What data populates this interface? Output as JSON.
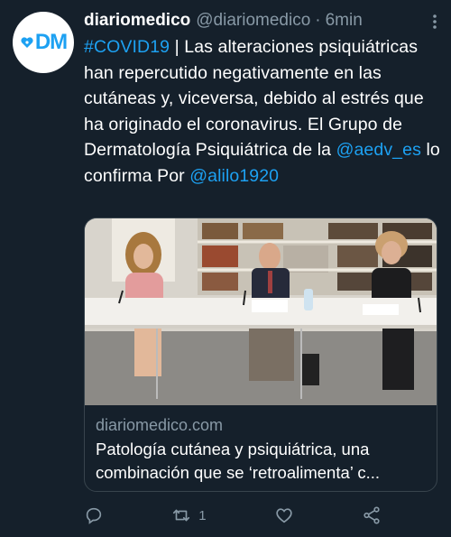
{
  "tweet": {
    "avatar_text": "DM",
    "author_name": "diariomedico",
    "handle": "@diariomedico",
    "separator": "·",
    "time": "6min",
    "text_parts": {
      "hashtag": "#COVID19",
      "body": " | Las alteraciones psiquiátricas han repercutido negativamente en las cutáneas y, viceversa, debido al estrés que ha originado el coronavirus. El Grupo de Dermatología Psiquiátrica de la ",
      "mention1": "@aedv_es",
      "middle": " lo confirma Por ",
      "mention2": "@alilo1920"
    }
  },
  "card": {
    "domain": "diariomedico.com",
    "title": "Patología cutánea y psiquiátrica, una combinación que se ‘retroalimenta’ c..."
  },
  "actions": {
    "reply_icon": "reply-icon",
    "retweet_icon": "retweet-icon",
    "retweet_count": "1",
    "like_icon": "heart-icon",
    "share_icon": "share-icon"
  },
  "colors": {
    "background": "#15202b",
    "accent": "#1da1f2",
    "muted": "#8899a6",
    "border": "#38444d"
  }
}
